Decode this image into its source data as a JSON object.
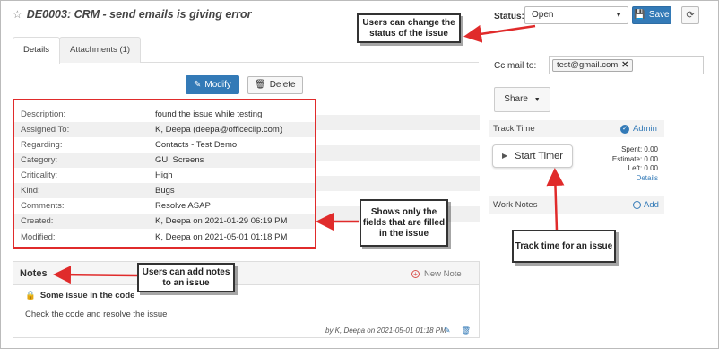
{
  "title": {
    "star_icon": "star-outline-icon",
    "text": "DE0003: CRM - send emails is giving error"
  },
  "tabs": [
    {
      "label": "Details"
    },
    {
      "label": "Attachments (1)"
    }
  ],
  "actions": {
    "modify": "Modify",
    "delete": "Delete"
  },
  "fields": [
    {
      "label": "Description:",
      "value": "found the issue while testing"
    },
    {
      "label": "Assigned To:",
      "value": "K, Deepa (deepa@officeclip.com)"
    },
    {
      "label": "Regarding:",
      "value": "Contacts - Test Demo"
    },
    {
      "label": "Category:",
      "value": "GUI Screens"
    },
    {
      "label": "Criticality:",
      "value": "High"
    },
    {
      "label": "Kind:",
      "value": "Bugs"
    },
    {
      "label": "Comments:",
      "value": "Resolve ASAP"
    },
    {
      "label": "Created:",
      "value": "K, Deepa on 2021-01-29 06:19 PM"
    },
    {
      "label": "Modified:",
      "value": "K, Deepa on 2021-05-01 01:18 PM"
    }
  ],
  "notes": {
    "title": "Notes",
    "new_note": "New Note",
    "item": {
      "title": "Some issue in the code",
      "body": "Check the code and resolve the issue",
      "meta": "by  K, Deepa on  2021-05-01 01:18 PM"
    }
  },
  "right": {
    "status_label": "Status:",
    "status_value": "Open",
    "save": "Save",
    "cc_label": "Cc mail to:",
    "cc_email": "test@gmail.com",
    "share": "Share",
    "track_time": "Track Time",
    "admin": "Admin",
    "start_timer": "Start Timer",
    "spent": "Spent: 0.00",
    "estimate": "Estimate: 0.00",
    "left": "Left: 0.00",
    "details": "Details",
    "work_notes": "Work Notes",
    "add": "Add"
  },
  "callouts": {
    "status": "Users can change the status of the issue",
    "fields": "Shows only the fields that are filled in the issue",
    "notes": "Users can add notes to an issue",
    "track": "Track time for an issue"
  },
  "colors": {
    "accent": "#337ab7",
    "callout_arrow": "#e02b2b"
  }
}
